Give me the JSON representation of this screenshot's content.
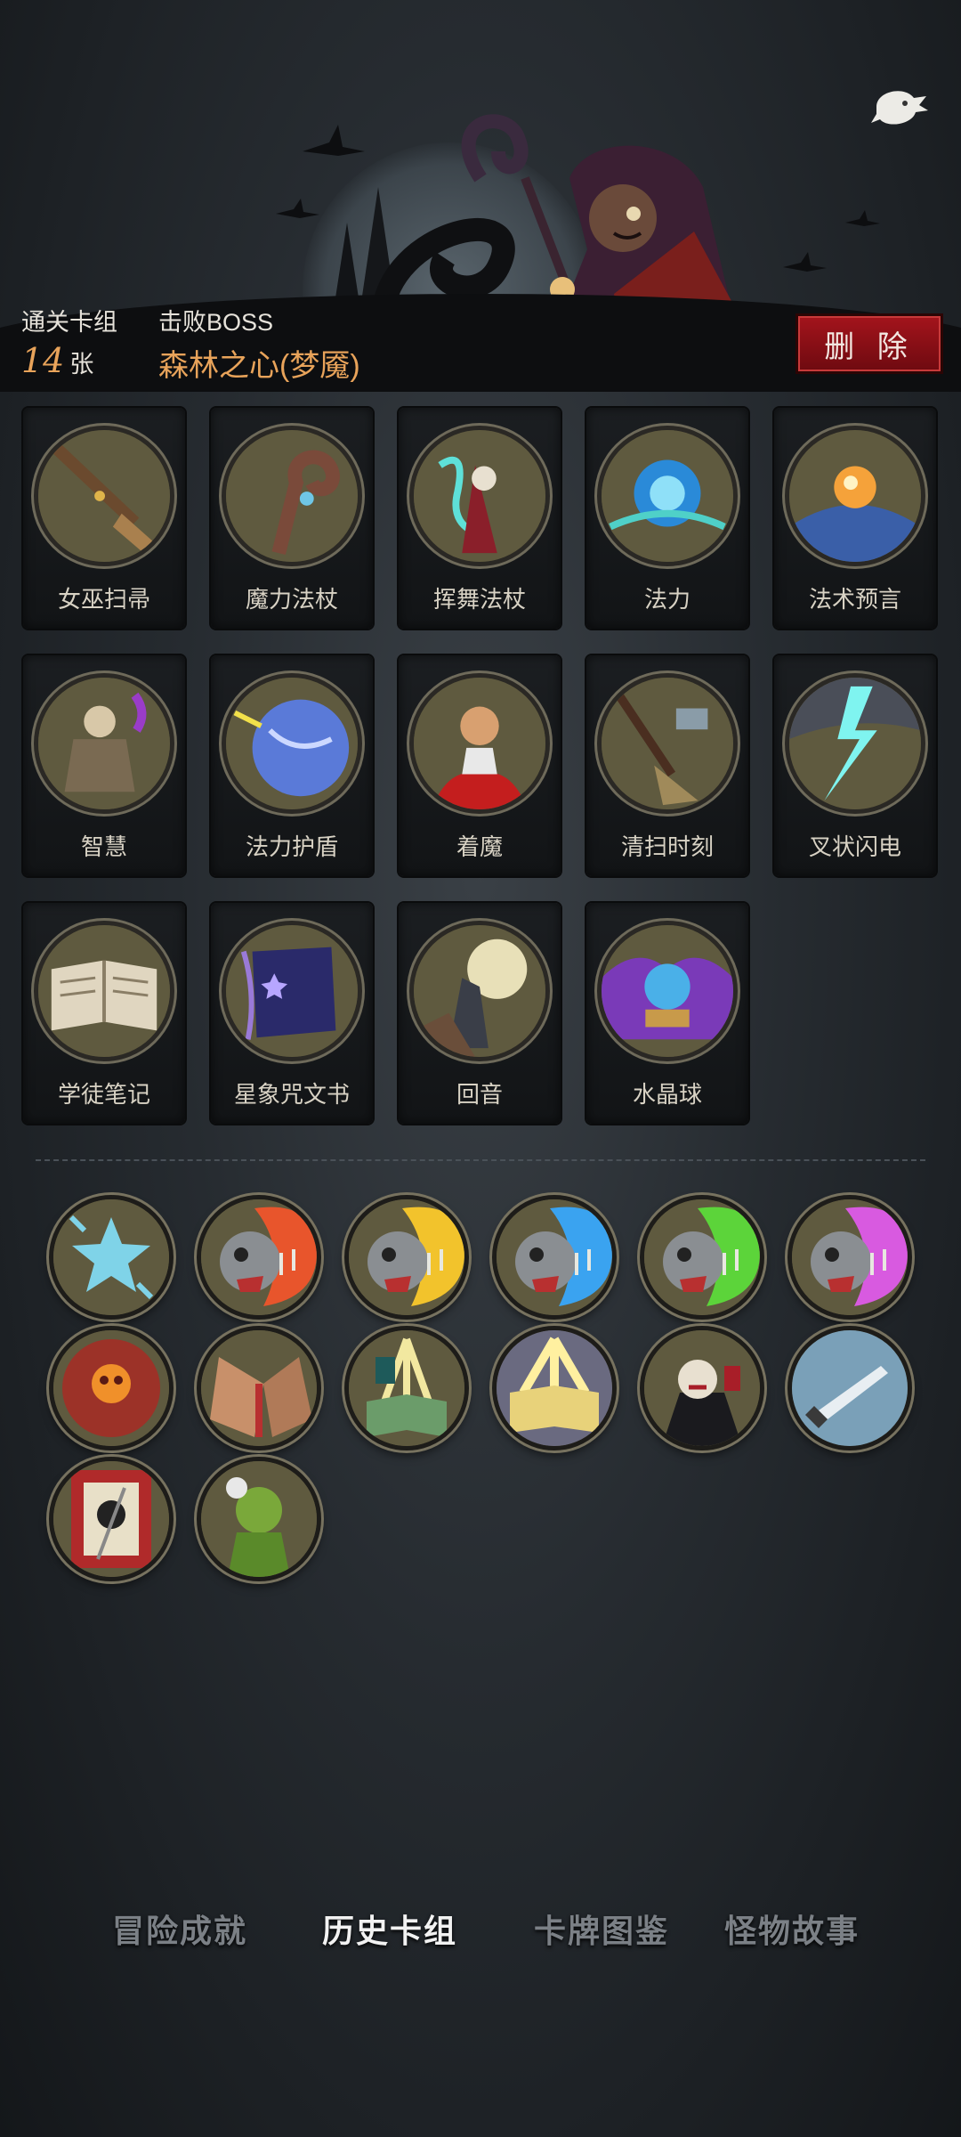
{
  "header": {
    "deck_label": "通关卡组",
    "deck_count": "14",
    "deck_unit": "张",
    "boss_label": "击败BOSS",
    "boss_name": "森林之心(梦魇)",
    "delete_label": "删 除"
  },
  "cards": [
    {
      "name": "女巫扫帚",
      "icon": "broom-icon"
    },
    {
      "name": "魔力法杖",
      "icon": "staff-icon"
    },
    {
      "name": "挥舞法杖",
      "icon": "witch-staff-icon"
    },
    {
      "name": "法力",
      "icon": "mana-orb-icon"
    },
    {
      "name": "法术预言",
      "icon": "prophecy-orb-icon"
    },
    {
      "name": "智慧",
      "icon": "scholar-icon"
    },
    {
      "name": "法力护盾",
      "icon": "shield-globe-icon"
    },
    {
      "name": "着魔",
      "icon": "possessed-icon"
    },
    {
      "name": "清扫时刻",
      "icon": "sweep-broom-icon"
    },
    {
      "name": "叉状闪电",
      "icon": "lightning-icon"
    },
    {
      "name": "学徒笔记",
      "icon": "notebook-icon"
    },
    {
      "name": "星象咒文书",
      "icon": "spellbook-icon"
    },
    {
      "name": "回音",
      "icon": "werewolf-moon-icon"
    },
    {
      "name": "水晶球",
      "icon": "crystal-ball-icon"
    }
  ],
  "relics": [
    {
      "icon": "star-shard-icon",
      "color": "#7fd3e8"
    },
    {
      "icon": "singing-skull-icon",
      "color": "#e8552c"
    },
    {
      "icon": "singing-skull-icon",
      "color": "#f2c32c"
    },
    {
      "icon": "singing-skull-icon",
      "color": "#3aa3f0"
    },
    {
      "icon": "singing-skull-icon",
      "color": "#5cd43a"
    },
    {
      "icon": "singing-skull-icon",
      "color": "#d85ae0"
    },
    {
      "icon": "skull-shield-icon",
      "color": "#9c3228"
    },
    {
      "icon": "bleeding-hands-icon",
      "color": "#b83030"
    },
    {
      "icon": "glowing-book-icon",
      "color": "#6b9c6a"
    },
    {
      "icon": "radiant-book-icon",
      "color": "#e8d27a"
    },
    {
      "icon": "vampire-icon",
      "color": "#a81e28"
    },
    {
      "icon": "dagger-icon",
      "color": "#7aa0b8"
    },
    {
      "icon": "skull-banner-icon",
      "color": "#b02a2a"
    },
    {
      "icon": "ghoul-icon",
      "color": "#7aa83a"
    }
  ],
  "tabs": [
    {
      "label": "冒险成就",
      "active": false
    },
    {
      "label": "历史卡组",
      "active": true
    },
    {
      "label": "卡牌图鉴",
      "active": false
    },
    {
      "label": "怪物故事",
      "active": false
    }
  ]
}
